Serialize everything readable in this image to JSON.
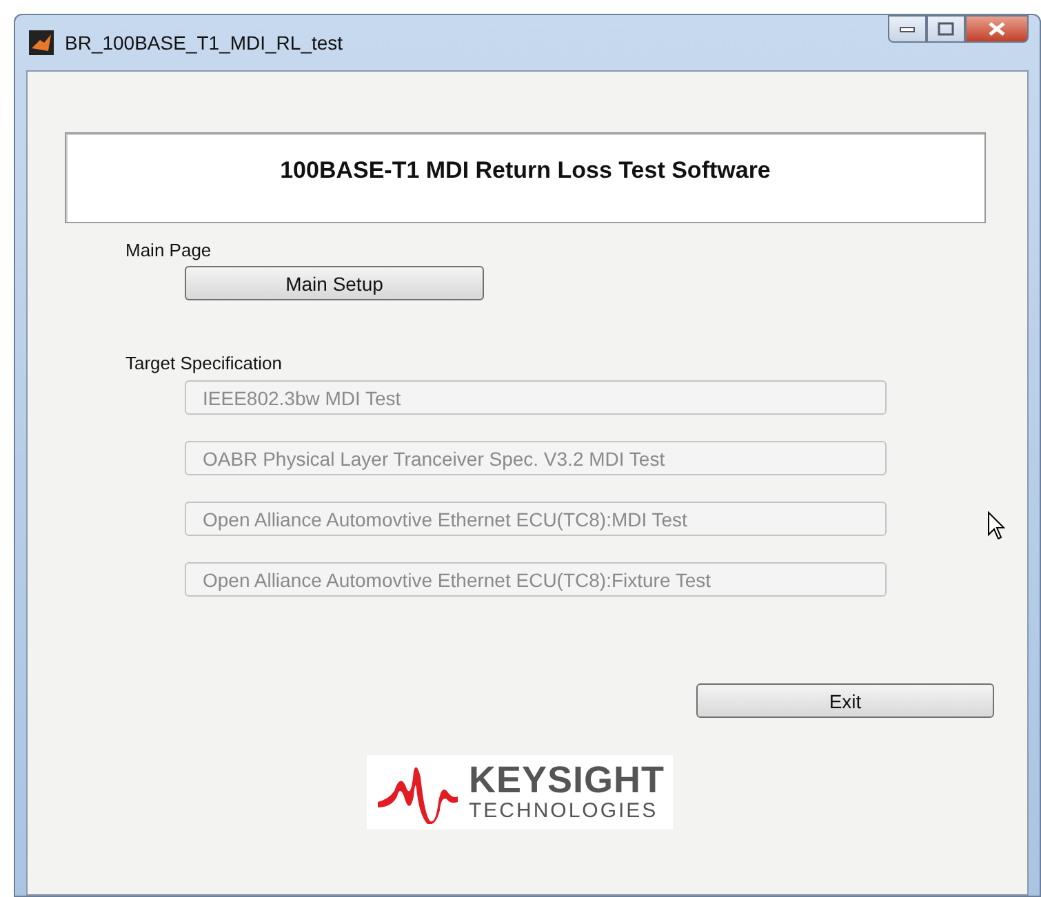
{
  "window": {
    "title": "BR_100BASE_T1_MDI_RL_test"
  },
  "banner": {
    "title": "100BASE-T1 MDI Return Loss Test Software"
  },
  "main_page": {
    "label": "Main Page",
    "button": {
      "label": "Main Setup",
      "disabled": false
    }
  },
  "target_specification": {
    "label": "Target Specification",
    "buttons": [
      {
        "label": "IEEE802.3bw MDI Test",
        "disabled": true
      },
      {
        "label": "OABR Physical Layer Tranceiver Spec. V3.2 MDI Test",
        "disabled": true
      },
      {
        "label": "Open Alliance Automovtive Ethernet ECU(TC8):MDI Test",
        "disabled": true
      },
      {
        "label": "Open Alliance Automovtive Ethernet ECU(TC8):Fixture Test",
        "disabled": true
      }
    ]
  },
  "exit_button": {
    "label": "Exit",
    "disabled": false
  },
  "logo": {
    "name": "KEYSIGHT",
    "subtitle": "TECHNOLOGIES"
  }
}
